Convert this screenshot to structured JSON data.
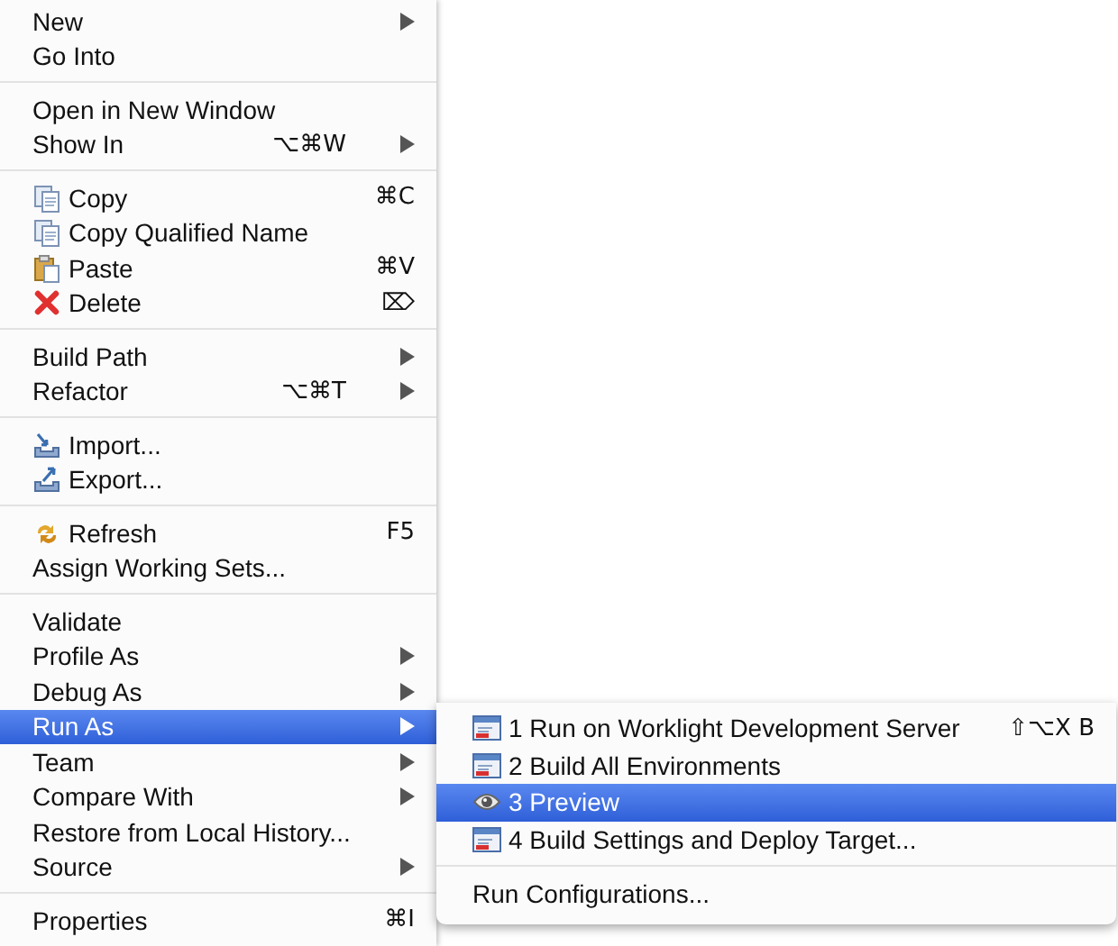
{
  "menu": {
    "groups": [
      {
        "items": [
          {
            "label": "New",
            "submenu": true,
            "selected": false
          },
          {
            "label": "Go Into",
            "submenu": false,
            "selected": false
          }
        ]
      },
      {
        "items": [
          {
            "label": "Open in New Window",
            "submenu": false,
            "selected": false
          },
          {
            "label": "Show In",
            "shortcut": "⌥⌘W",
            "submenu": true,
            "selected": false
          }
        ]
      },
      {
        "items": [
          {
            "label": "Copy",
            "kind": "copy",
            "shortcut": "⌘C",
            "submenu": false,
            "selected": false
          },
          {
            "label": "Copy Qualified Name",
            "kind": "copy-qualified",
            "submenu": false,
            "selected": false
          },
          {
            "label": "Paste",
            "kind": "paste",
            "shortcut": "⌘V",
            "submenu": false,
            "selected": false
          },
          {
            "label": "Delete",
            "kind": "delete",
            "shortcut": "⌦",
            "submenu": false,
            "selected": false
          }
        ]
      },
      {
        "items": [
          {
            "label": "Build Path",
            "submenu": true,
            "selected": false
          },
          {
            "label": "Refactor",
            "shortcut": "⌥⌘T",
            "submenu": true,
            "selected": false
          }
        ]
      },
      {
        "items": [
          {
            "label": "Import...",
            "kind": "import",
            "submenu": false,
            "selected": false
          },
          {
            "label": "Export...",
            "kind": "export",
            "submenu": false,
            "selected": false
          }
        ]
      },
      {
        "items": [
          {
            "label": "Refresh",
            "kind": "refresh",
            "shortcut": "F5",
            "submenu": false,
            "selected": false
          },
          {
            "label": "Assign Working Sets...",
            "submenu": false,
            "selected": false
          }
        ]
      },
      {
        "items": [
          {
            "label": "Validate",
            "submenu": false,
            "selected": false
          },
          {
            "label": "Profile As",
            "submenu": true,
            "selected": false
          },
          {
            "label": "Debug As",
            "submenu": true,
            "selected": false
          },
          {
            "label": "Run As",
            "submenu": true,
            "selected": true
          },
          {
            "label": "Team",
            "submenu": true,
            "selected": false
          },
          {
            "label": "Compare With",
            "submenu": true,
            "selected": false
          },
          {
            "label": "Restore from Local History...",
            "submenu": false,
            "selected": false
          },
          {
            "label": "Source",
            "submenu": true,
            "selected": false
          }
        ]
      },
      {
        "items": [
          {
            "label": "Properties",
            "shortcut": "⌘I",
            "submenu": false,
            "selected": false
          }
        ]
      }
    ]
  },
  "run_as_submenu": {
    "groups": [
      {
        "items": [
          {
            "label": "1 Run on Worklight Development Server",
            "kind": "app",
            "shortcut": "⇧⌥X B",
            "selected": false
          },
          {
            "label": "2 Build All Environments",
            "kind": "app",
            "selected": false
          },
          {
            "label": "3 Preview",
            "kind": "eye",
            "selected": true
          },
          {
            "label": "4 Build Settings and Deploy Target...",
            "kind": "app",
            "selected": false
          }
        ]
      },
      {
        "items": [
          {
            "label": "Run Configurations...",
            "selected": false
          }
        ]
      }
    ]
  }
}
